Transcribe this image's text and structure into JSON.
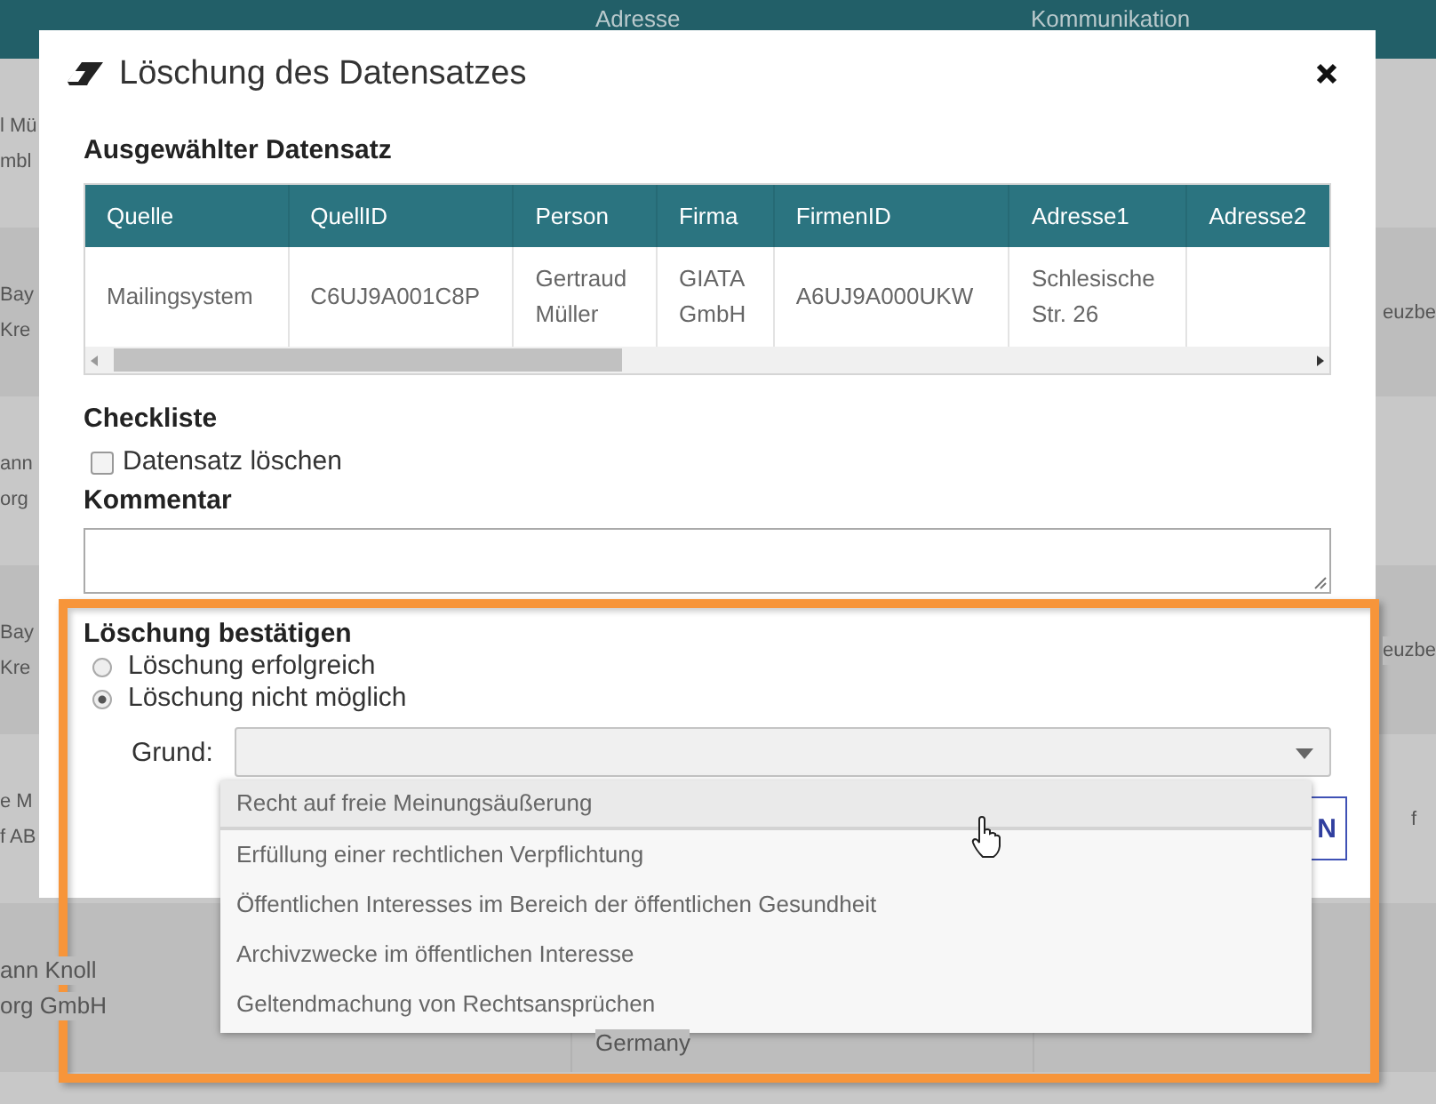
{
  "background_table": {
    "columns": [
      {
        "label": "Adresse"
      },
      {
        "label": "Kommunikation"
      }
    ],
    "rows": [
      {
        "column_1": [
          "l Mü",
          "mbl"
        ]
      },
      {
        "column_1": [
          "Bay",
          "Kre"
        ],
        "column_3": [
          "euzbe"
        ]
      },
      {
        "column_1": [
          "ann",
          "org"
        ]
      },
      {
        "column_1": [
          "Bay",
          "Kre"
        ],
        "column_3": [
          "euzbe"
        ]
      },
      {
        "column_1": [
          "e M",
          "f AB"
        ],
        "column_3": [
          "f"
        ]
      },
      {
        "column_1": [
          "ann Knoll",
          "org GmbH"
        ],
        "column_2": [
          "Germany"
        ]
      }
    ]
  },
  "dialog": {
    "title": "Löschung des Datensatzes",
    "record_heading": "Ausgewählter Datensatz",
    "record_table": {
      "columns": [
        "Quelle",
        "QuellID",
        "Person",
        "Firma",
        "FirmenID",
        "Adresse1",
        "Adresse2"
      ],
      "rows": [
        [
          "Mailingsystem",
          "C6UJ9A001C8P",
          "Gertraud Müller",
          "GIATA GmbH",
          "A6UJ9A000UKW",
          "Schlesische Str. 26",
          ""
        ]
      ]
    },
    "checklist": {
      "title": "Checkliste",
      "items": [
        {
          "label": "Datensatz löschen",
          "checked": false
        }
      ]
    },
    "comment": {
      "label": "Kommentar"
    },
    "confirmation": {
      "title": "Löschung bestätigen",
      "options": [
        {
          "label": "Löschung erfolgreich",
          "selected": false
        },
        {
          "label": "Löschung nicht möglich",
          "selected": true
        }
      ],
      "reason_label": "Grund:",
      "reason_dropdown": {
        "expanded": true,
        "options": [
          {
            "label": "Recht auf freie Meinungsäußerung",
            "highlighted": true
          },
          {
            "label": "Erfüllung einer rechtlichen Verpflichtung",
            "highlighted": false
          },
          {
            "label": "Öffentlichen Interesses im Bereich der öffentlichen Gesundheit",
            "highlighted": false
          },
          {
            "label": "Archivzwecke im öffentlichen Interesse",
            "highlighted": false
          },
          {
            "label": "Geltendmachung von Rechtsansprüchen",
            "highlighted": false
          }
        ]
      }
    },
    "partial_button": "N"
  }
}
